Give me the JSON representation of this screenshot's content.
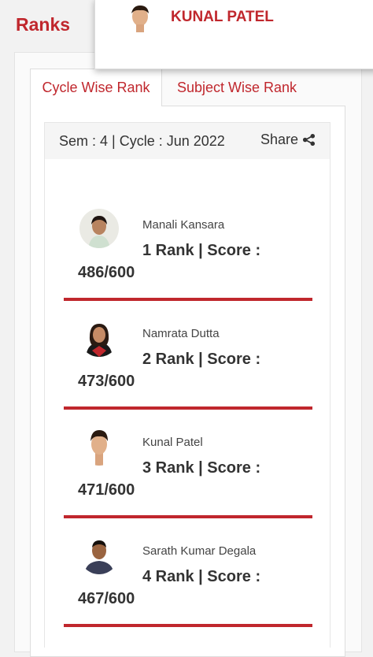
{
  "page": {
    "title": "Ranks"
  },
  "user_card": {
    "name": "KUNAL PATEL"
  },
  "tabs": [
    {
      "label": "Cycle Wise Rank",
      "active": true
    },
    {
      "label": "Subject Wise Rank",
      "active": false
    }
  ],
  "card": {
    "sem_info": "Sem : 4 | Cycle : Jun 2022",
    "share_label": "Share",
    "share_icon": "share-icon"
  },
  "ranks": [
    {
      "name": "Manali Kansara",
      "line1": "1 Rank | Score :",
      "line2": "486/600"
    },
    {
      "name": "Namrata Dutta",
      "line1": "2 Rank | Score :",
      "line2": "473/600"
    },
    {
      "name": "Kunal Patel",
      "line1": "3 Rank | Score :",
      "line2": "471/600"
    },
    {
      "name": "Sarath Kumar Degala",
      "line1": "4 Rank | Score :",
      "line2": "467/600"
    }
  ],
  "colors": {
    "accent": "#c0272d"
  }
}
